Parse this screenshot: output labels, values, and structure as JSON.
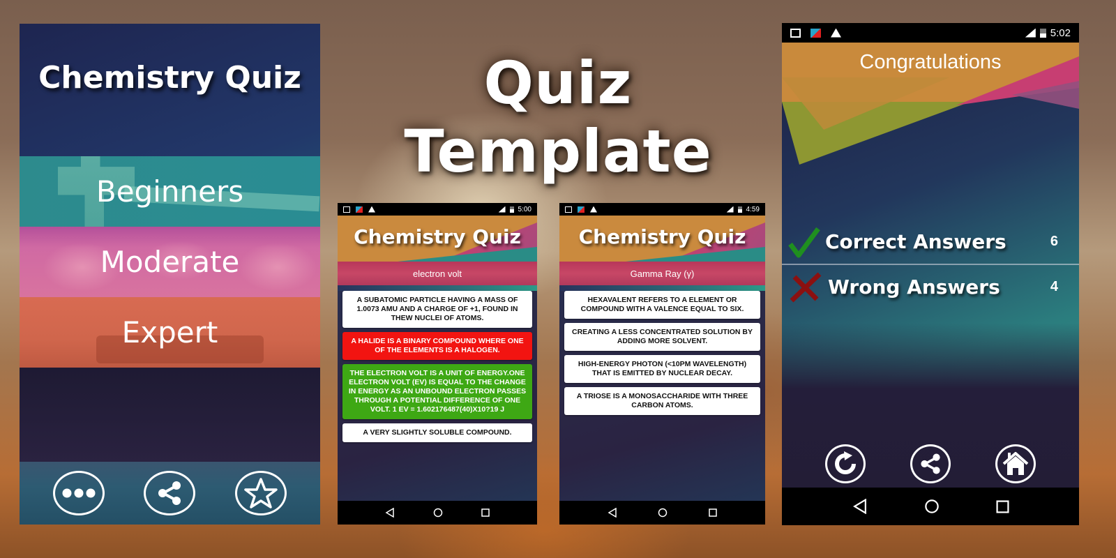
{
  "headline": "Quiz Template",
  "menu_screen": {
    "title": "Chemistry Quiz",
    "levels": [
      {
        "label": "Beginners",
        "color": "#2a8c93"
      },
      {
        "label": "Moderate",
        "color": "#d06aa3"
      },
      {
        "label": "Expert",
        "color": "#d0664c"
      }
    ],
    "footer_buttons": [
      {
        "icon": "more-dots-icon",
        "action": "more"
      },
      {
        "icon": "share-icon",
        "action": "share"
      },
      {
        "icon": "star-icon",
        "action": "rate"
      }
    ]
  },
  "quiz_screens": [
    {
      "status_time": "5:00",
      "title": "Chemistry Quiz",
      "question": "electron volt",
      "answers": [
        {
          "text": "A SUBATOMIC PARTICLE HAVING A MASS OF 1.0073 AMU AND A CHARGE OF +1, FOUND IN THEW NUCLEI OF ATOMS.",
          "state": "neutral"
        },
        {
          "text": "A HALIDE IS A BINARY COMPOUND WHERE ONE OF THE ELEMENTS IS A HALOGEN.",
          "state": "wrong"
        },
        {
          "text": "THE ELECTRON VOLT IS A UNIT OF ENERGY.ONE ELECTRON VOLT (EV) IS EQUAL TO THE CHANGE IN ENERGY AS AN UNBOUND ELECTRON PASSES THROUGH A POTENTIAL DIFFERENCE OF ONE VOLT. 1 EV = 1.602176487(40)X10?19 J",
          "state": "correct"
        },
        {
          "text": "A VERY SLIGHTLY SOLUBLE COMPOUND.",
          "state": "neutral"
        }
      ]
    },
    {
      "status_time": "4:59",
      "title": "Chemistry Quiz",
      "question": "Gamma Ray (γ)",
      "answers": [
        {
          "text": "HEXAVALENT REFERS TO A ELEMENT OR COMPOUND WITH A VALENCE EQUAL TO SIX.",
          "state": "neutral"
        },
        {
          "text": "CREATING A LESS CONCENTRATED SOLUTION BY ADDING MORE SOLVENT.",
          "state": "neutral"
        },
        {
          "text": "HIGH-ENERGY PHOTON (<10PM WAVELENGTH) THAT IS EMITTED BY NUCLEAR DECAY.",
          "state": "neutral"
        },
        {
          "text": "A TRIOSE IS A MONOSACCHARIDE WITH THREE CARBON ATOMS.",
          "state": "neutral"
        }
      ]
    }
  ],
  "result_screen": {
    "status_time": "5:02",
    "title": "Congratulations",
    "correct": {
      "label": "Correct Answers",
      "value": "6",
      "icon_color": "#1f8f1f"
    },
    "wrong": {
      "label": "Wrong Answers",
      "value": "4",
      "icon_color": "#8b1010"
    },
    "actions": [
      {
        "icon": "replay-icon",
        "action": "retry"
      },
      {
        "icon": "share-icon",
        "action": "share"
      },
      {
        "icon": "home-icon",
        "action": "home"
      }
    ]
  },
  "status_icons": [
    "image-icon",
    "app-icon",
    "warning-icon",
    "signal-icon",
    "battery-icon"
  ],
  "nav_icons": [
    "back-icon",
    "home-nav-icon",
    "recents-icon"
  ]
}
